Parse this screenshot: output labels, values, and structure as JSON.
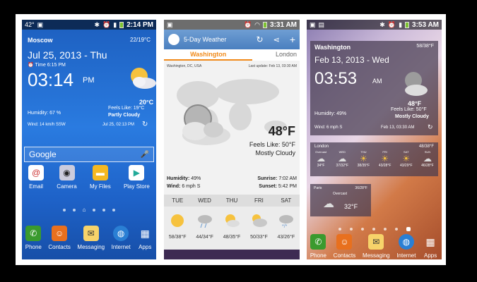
{
  "phone1": {
    "status": {
      "temp": "42°",
      "time": "2:14 PM"
    },
    "city": "Moscow",
    "hi_lo": "22/19°C",
    "date": "Jul 25, 2013 - Thu",
    "local_time_label": "Time 6:15 PM",
    "local_time_value": "Time 6:15 PM",
    "clock": "03:14",
    "ampm": "PM",
    "temp": "20°C",
    "feels_like": "Feels Like: 19°C",
    "condition": "Partly Cloudy",
    "humidity": "Humidity: 67 %",
    "wind": "Wind: 14 km/h SSW",
    "updated": "Jul 25, 02:13 PM",
    "search_label": "Google",
    "apps": [
      "Email",
      "Camera",
      "My Files",
      "Play Store"
    ],
    "dock": [
      "Phone",
      "Contacts",
      "Messaging",
      "Internet",
      "Apps"
    ]
  },
  "phone2": {
    "status": {
      "time": "3:31 AM"
    },
    "app_title": "5-Day Weather",
    "tabs": [
      "Washington",
      "London"
    ],
    "location": "Washington, DC, USA",
    "last_update": "Last update: Feb 13, 03:30 AM",
    "temp": "48°F",
    "feels_like": "Feels Like: 50°F",
    "condition": "Mostly Cloudy",
    "humidity_label": "Humidity:",
    "humidity_value": "49%",
    "wind_label": "Wind:",
    "wind_value": "6 mph S",
    "sunrise_label": "Sunrise:",
    "sunrise_value": "7:02 AM",
    "sunset_label": "Sunset:",
    "sunset_value": "5:42 PM",
    "forecast": [
      {
        "day": "TUE",
        "temps": "58/38°F",
        "cond": "Fair"
      },
      {
        "day": "WED",
        "temps": "44/34°F",
        "cond": "Light Rain"
      },
      {
        "day": "THU",
        "temps": "48/35°F",
        "cond": "Partly Cloudy"
      },
      {
        "day": "FRI",
        "temps": "50/33°F",
        "cond": "Mostly Cloudy"
      },
      {
        "day": "SAT",
        "temps": "43/26°F",
        "cond": "Rain and Snow"
      }
    ]
  },
  "phone3": {
    "status": {
      "time": "3:53 AM"
    },
    "city": "Washington",
    "hi_lo": "58/38°F",
    "date": "Feb 13, 2013 - Wed",
    "clock": "03:53",
    "ampm": "AM",
    "temp": "48°F",
    "feels_like": "Feels Like: 50°F",
    "condition": "Mostly Cloudy",
    "humidity": "Humidity: 49%",
    "wind": "Wind: 6 mph S",
    "updated": "Feb 13, 03:30 AM",
    "london": {
      "city": "London",
      "hi_lo": "48/38°F",
      "days": [
        {
          "day": "Overcast",
          "temp": "34°F"
        },
        {
          "day": "WED",
          "temp": "37/32°F"
        },
        {
          "day": "THU",
          "temp": "38/35°F"
        },
        {
          "day": "FRI",
          "temp": "43/28°F"
        },
        {
          "day": "SAT",
          "temp": "43/29°F"
        },
        {
          "day": "SUN",
          "temp": "46/28°F"
        }
      ]
    },
    "paris": {
      "city": "Paris",
      "hi_lo": "36/28°F",
      "condition": "Overcast",
      "temp": "32°F"
    },
    "dock": [
      "Phone",
      "Contacts",
      "Messaging",
      "Internet",
      "Apps"
    ]
  },
  "colors": {
    "accent_orange": "#f08a1a",
    "dock_green": "#3a9a2e"
  }
}
